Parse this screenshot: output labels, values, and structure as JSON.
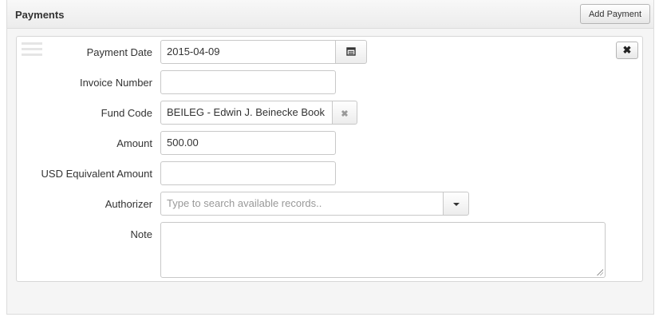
{
  "panel": {
    "title": "Payments",
    "add_button_label": "Add Payment"
  },
  "icons": {
    "drag": "drag-handle-icon",
    "remove": "close-icon",
    "calendar": "calendar-icon",
    "clear": "clear-x-icon",
    "dropdown": "caret-down-icon"
  },
  "form": {
    "payment_date": {
      "label": "Payment Date",
      "value": "2015-04-09"
    },
    "invoice_number": {
      "label": "Invoice Number",
      "value": ""
    },
    "fund_code": {
      "label": "Fund Code",
      "value": "BEILEG - Edwin J. Beinecke Book"
    },
    "amount": {
      "label": "Amount",
      "value": "500.00"
    },
    "usd_equivalent": {
      "label": "USD Equivalent Amount",
      "value": ""
    },
    "authorizer": {
      "label": "Authorizer",
      "placeholder": "Type to search available records.."
    },
    "note": {
      "label": "Note",
      "value": ""
    }
  }
}
